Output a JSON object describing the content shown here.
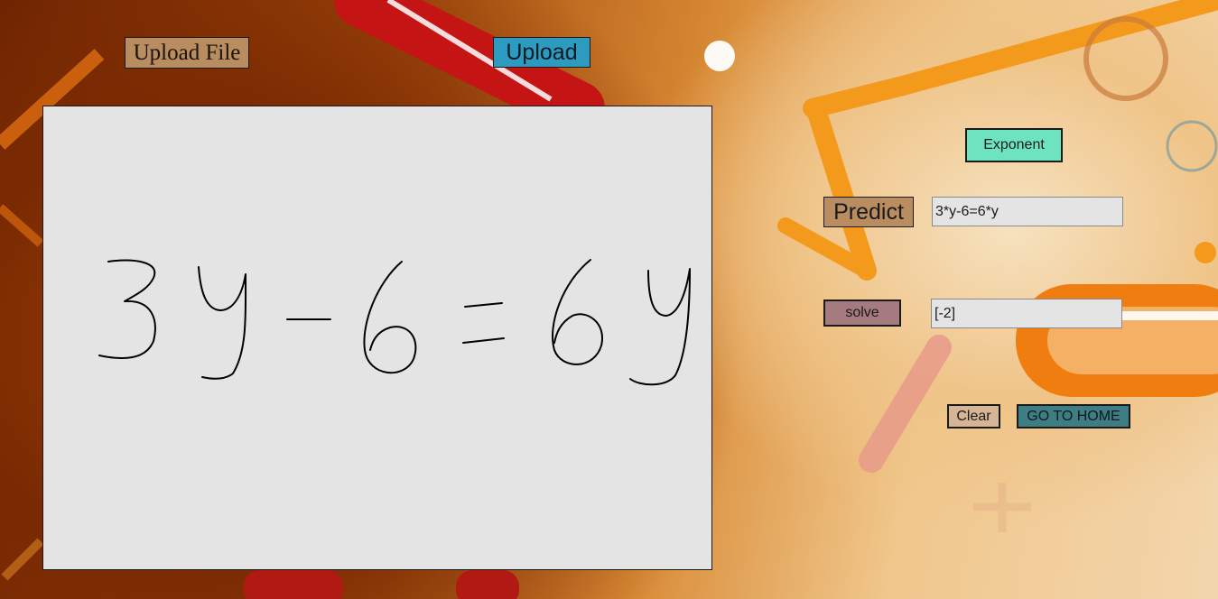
{
  "toolbar": {
    "upload_file_label": "Upload File",
    "upload_label": "Upload"
  },
  "canvas": {
    "handwritten_expression": "3y-6=6y",
    "background_color": "#e4e4e4",
    "stroke_color": "#000000"
  },
  "controls": {
    "exponent_label": "Exponent",
    "predict_label": "Predict",
    "predict_value": "3*y-6=6*y",
    "solve_label": "solve",
    "solve_value": "[-2]",
    "clear_label": "Clear",
    "home_label": "GO TO HOME"
  },
  "colors": {
    "upload_file_button": "#b98d5f",
    "upload_button": "#2d9ac0",
    "exponent_button": "#6ee3bf",
    "predict_button": "#b98d5f",
    "solve_button": "#a57b7f",
    "clear_button": "#d5b595",
    "home_button": "#3f7d84"
  }
}
